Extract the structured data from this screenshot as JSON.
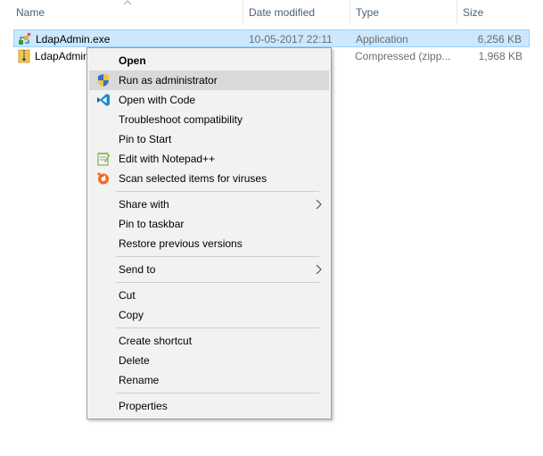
{
  "columns": {
    "name": "Name",
    "date_modified": "Date modified",
    "type": "Type",
    "size": "Size"
  },
  "files": [
    {
      "name": "LdapAdmin.exe",
      "date": "10-05-2017 22:11",
      "type": "Application",
      "size": "6,256 KB",
      "icon": "application-icon",
      "selected": true
    },
    {
      "name": "LdapAdmin",
      "date": "",
      "type": "Compressed (zipp...",
      "size": "1,968 KB",
      "icon": "zip-folder-icon",
      "selected": false
    }
  ],
  "context_menu": {
    "groups": [
      [
        {
          "label": "Open",
          "bold": true
        },
        {
          "label": "Run as administrator",
          "icon": "uac-shield-icon",
          "highlighted": true
        },
        {
          "label": "Open with Code",
          "icon": "vscode-icon"
        },
        {
          "label": "Troubleshoot compatibility"
        },
        {
          "label": "Pin to Start"
        },
        {
          "label": "Edit with Notepad++",
          "icon": "notepad-plus-plus-icon"
        },
        {
          "label": "Scan selected items for viruses",
          "icon": "avast-icon"
        }
      ],
      [
        {
          "label": "Share with",
          "submenu": true
        },
        {
          "label": "Pin to taskbar"
        },
        {
          "label": "Restore previous versions"
        }
      ],
      [
        {
          "label": "Send to",
          "submenu": true
        }
      ],
      [
        {
          "label": "Cut"
        },
        {
          "label": "Copy"
        }
      ],
      [
        {
          "label": "Create shortcut"
        },
        {
          "label": "Delete"
        },
        {
          "label": "Rename"
        }
      ],
      [
        {
          "label": "Properties"
        }
      ]
    ]
  },
  "colors": {
    "selection_bg": "#cce8ff",
    "selection_border": "#99d1ff",
    "menu_bg": "#f2f2f2",
    "menu_highlight": "#d9d9d9",
    "header_text": "#4c607a"
  }
}
